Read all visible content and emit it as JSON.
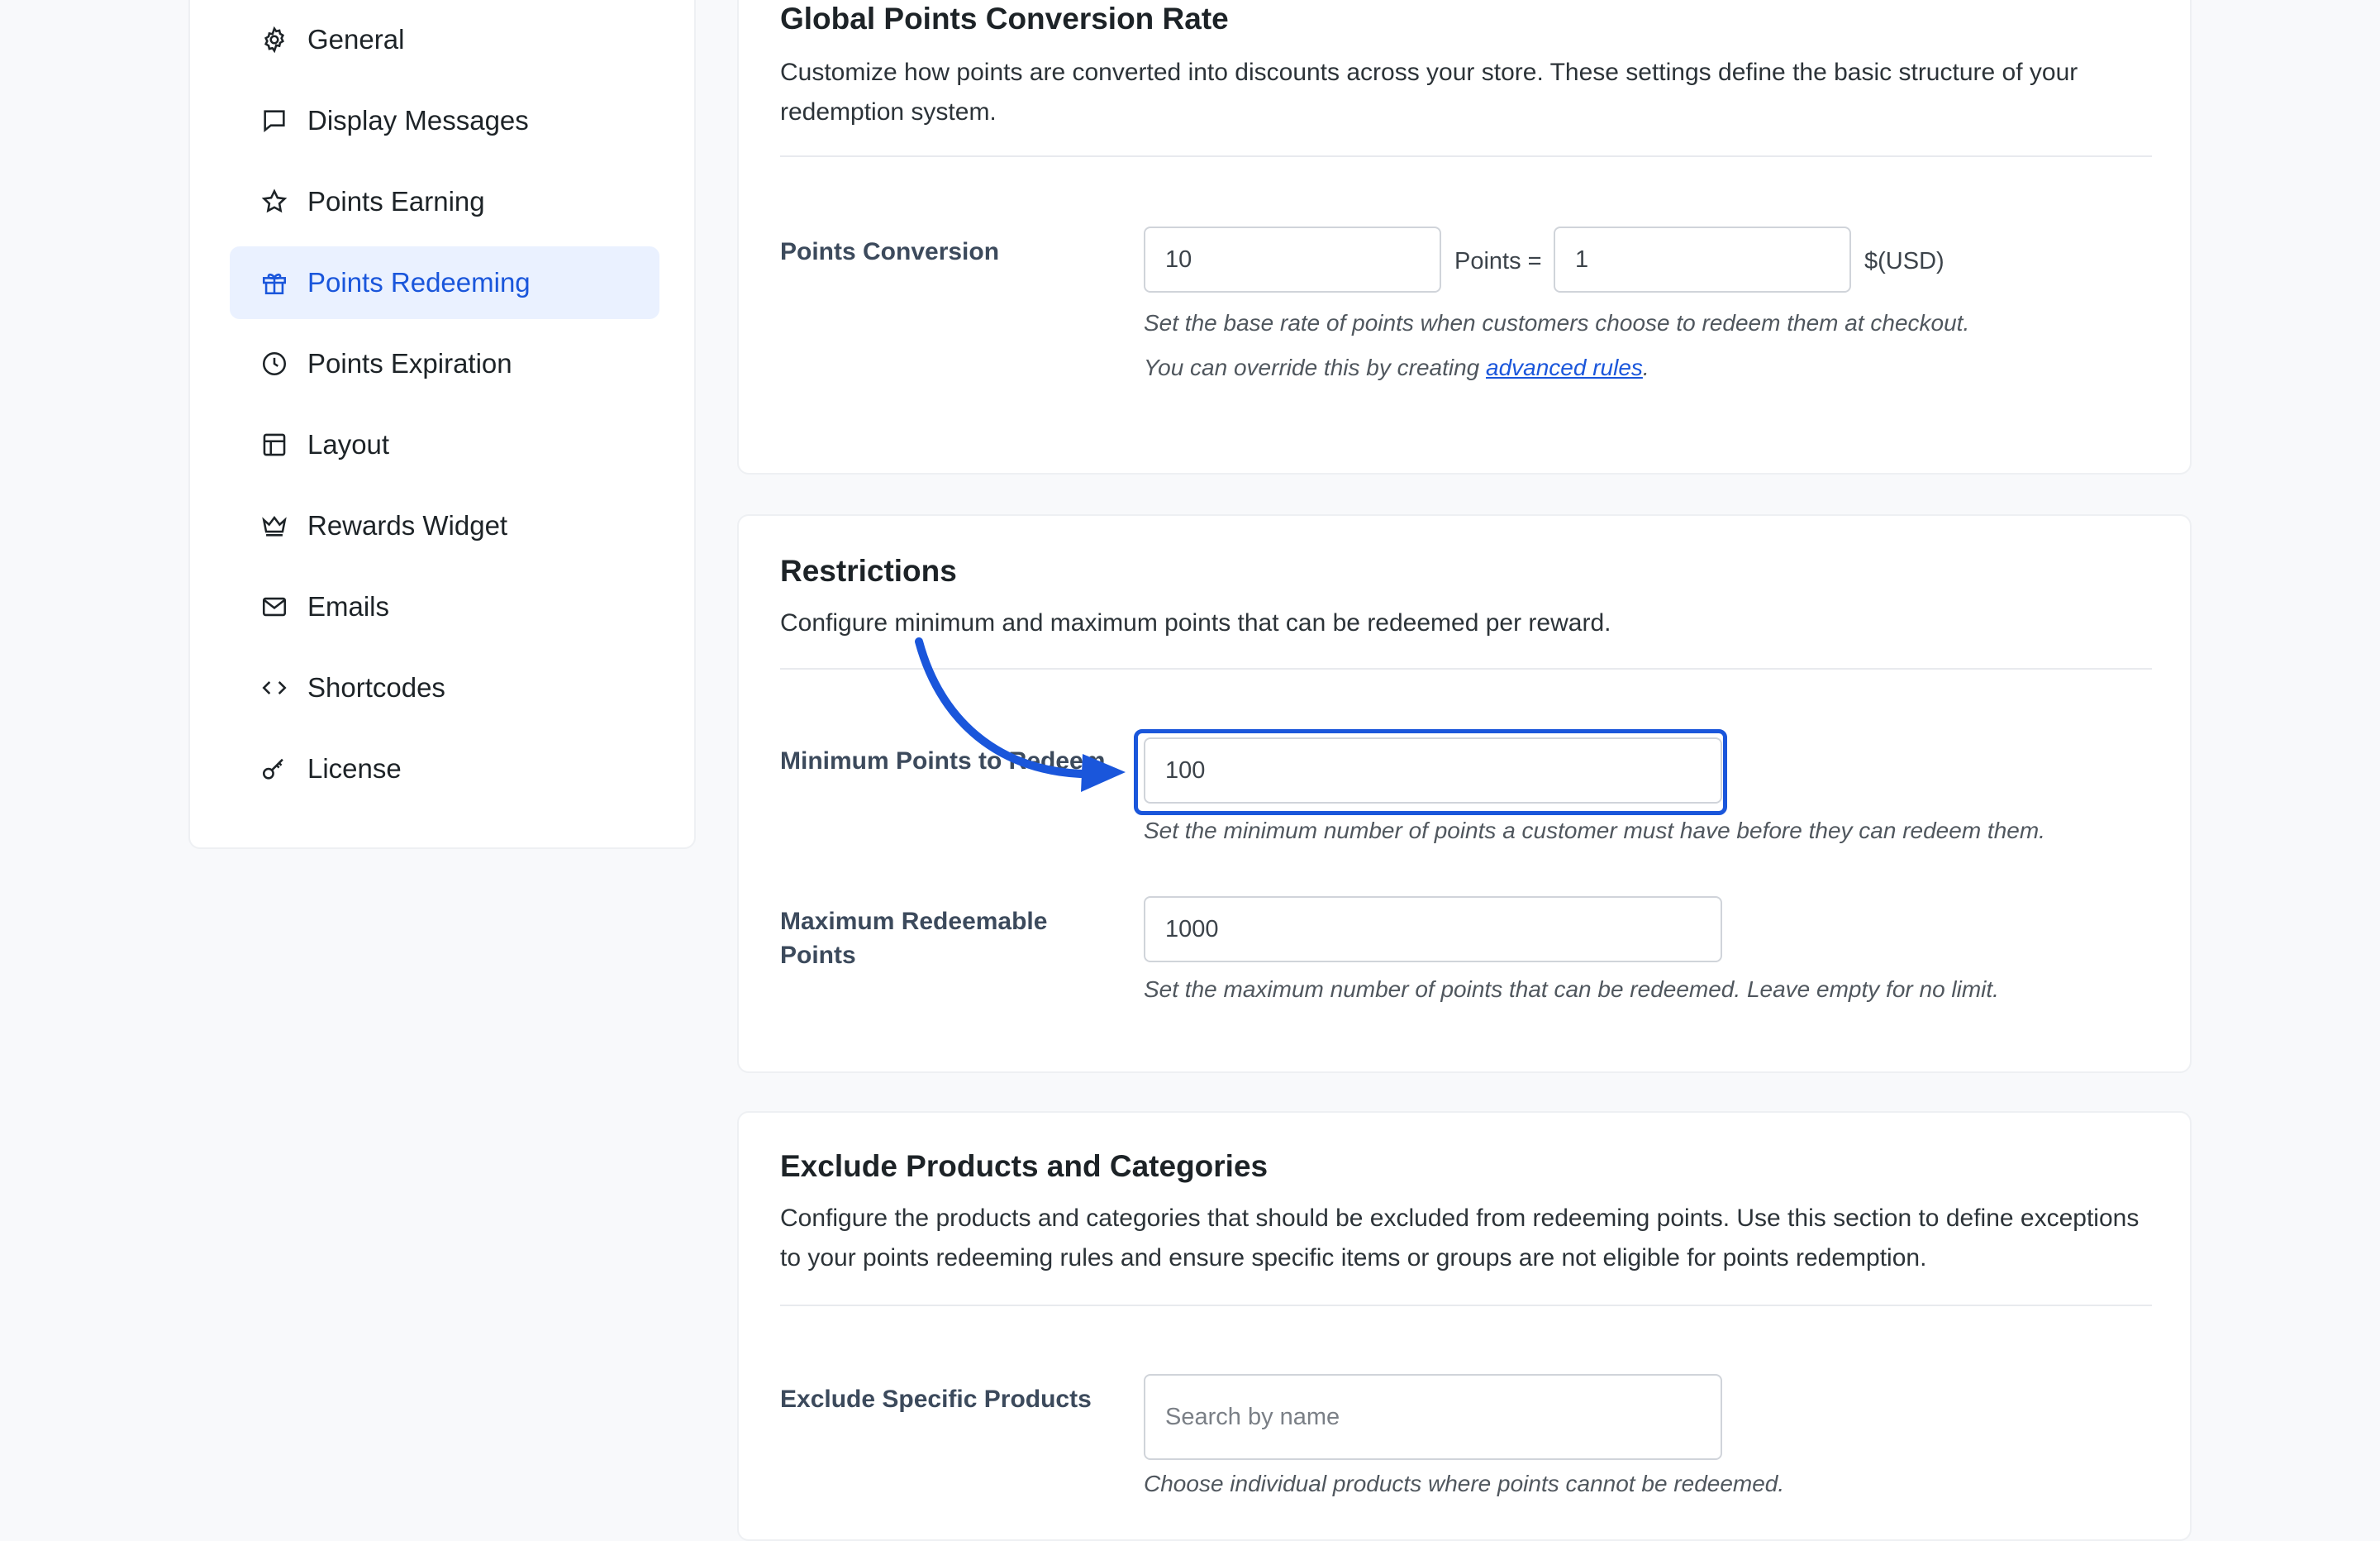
{
  "sidebar": {
    "items": [
      {
        "label": "General",
        "icon": "gear-icon"
      },
      {
        "label": "Display Messages",
        "icon": "message-icon"
      },
      {
        "label": "Points Earning",
        "icon": "star-icon"
      },
      {
        "label": "Points Redeeming",
        "icon": "gift-icon",
        "active": true
      },
      {
        "label": "Points Expiration",
        "icon": "clock-icon"
      },
      {
        "label": "Layout",
        "icon": "layout-icon"
      },
      {
        "label": "Rewards Widget",
        "icon": "crown-icon"
      },
      {
        "label": "Emails",
        "icon": "mail-icon"
      },
      {
        "label": "Shortcodes",
        "icon": "code-icon"
      },
      {
        "label": "License",
        "icon": "key-icon"
      }
    ]
  },
  "conversion": {
    "title": "Global Points Conversion Rate",
    "description": "Customize how points are converted into discounts across your store. These settings define the basic structure of your redemption system.",
    "field_label": "Points Conversion",
    "points_value": "10",
    "points_equals": "Points =",
    "currency_value": "1",
    "currency_label": "$(USD)",
    "help_line1": "Set the base rate of points when customers choose to redeem them at checkout.",
    "help_line2_prefix": "You can override this by creating ",
    "help_link": "advanced rules",
    "help_line2_suffix": "."
  },
  "restrictions": {
    "title": "Restrictions",
    "description": "Configure minimum and maximum points that can be redeemed per reward.",
    "min_label": "Minimum Points to Redeem",
    "min_value": "100",
    "min_help": "Set the minimum number of points a customer must have before they can redeem them.",
    "max_label": "Maximum Redeemable Points",
    "max_value": "1000",
    "max_help": "Set the maximum number of points that can be redeemed. Leave empty for no limit."
  },
  "exclude": {
    "title": "Exclude Products and Categories",
    "description": "Configure the products and categories that should be excluded from redeeming points. Use this section to define exceptions to your points redeeming rules and ensure specific items or groups are not eligible for points redemption.",
    "products_label": "Exclude Specific Products",
    "products_placeholder": "Search by name",
    "products_help": "Choose individual products where points cannot be redeemed."
  },
  "colors": {
    "accent": "#1a56db",
    "active_bg": "#eaf1ff"
  }
}
